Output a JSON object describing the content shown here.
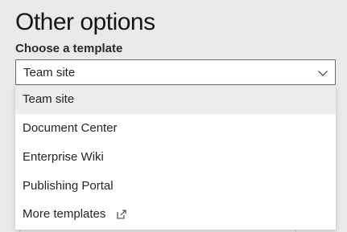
{
  "page": {
    "title": "Other options"
  },
  "template_field": {
    "label": "Choose a template",
    "selected_value": "Team site",
    "icon": "chevron-down-icon",
    "options": [
      {
        "label": "Team site",
        "selected": true
      },
      {
        "label": "Document Center",
        "selected": false
      },
      {
        "label": "Enterprise Wiki",
        "selected": false
      },
      {
        "label": "Publishing Portal",
        "selected": false
      },
      {
        "label": "More templates",
        "selected": false,
        "icon": "external-link-icon"
      }
    ]
  },
  "colors": {
    "background": "#e9e9e9",
    "selected_option": "#ececec",
    "border": "#6a6a6a"
  }
}
